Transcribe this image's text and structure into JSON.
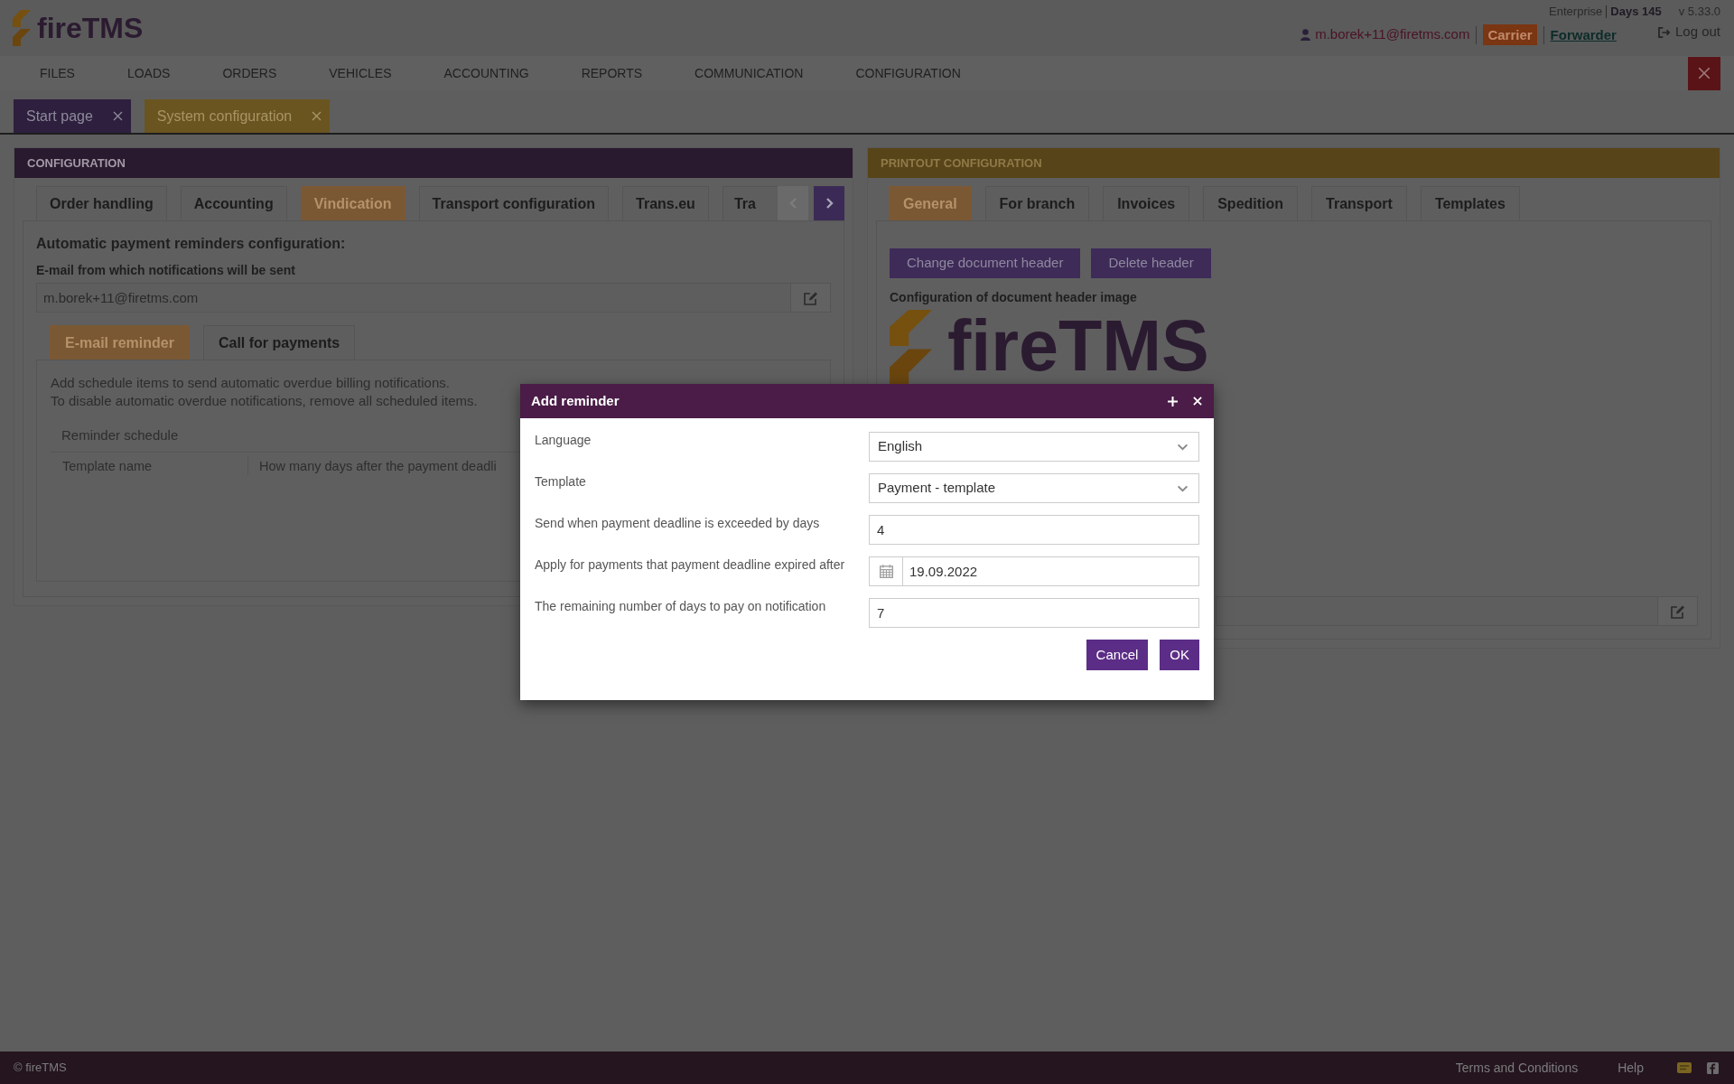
{
  "header": {
    "logo": "fireTMS",
    "edition": "Enterprise",
    "days": "Days 145",
    "version": "v 5.33.0",
    "user": "m.borek+11@firetms.com",
    "roles": [
      {
        "label": "Carrier",
        "selected": true
      },
      {
        "label": "Forwarder",
        "selected": false
      }
    ],
    "logout": "Log out"
  },
  "menu": [
    "FILES",
    "LOADS",
    "ORDERS",
    "VEHICLES",
    "ACCOUNTING",
    "REPORTS",
    "COMMUNICATION",
    "CONFIGURATION"
  ],
  "page_tabs": [
    {
      "label": "Start page",
      "selected": false
    },
    {
      "label": "System configuration",
      "selected": true
    }
  ],
  "configuration": {
    "title": "CONFIGURATION",
    "tabs": [
      {
        "label": "Order handling",
        "selected": false
      },
      {
        "label": "Accounting",
        "selected": false
      },
      {
        "label": "Vindication",
        "selected": true
      },
      {
        "label": "Transport configuration",
        "selected": false
      },
      {
        "label": "Trans.eu",
        "selected": false
      },
      {
        "label": "Tra",
        "selected": false
      }
    ],
    "scroll_buttons": [
      {
        "kind": "prev",
        "disabled": true
      },
      {
        "kind": "next",
        "disabled": false
      }
    ],
    "heading": "Automatic payment reminders configuration:",
    "email_label": "E-mail from which notifications will be sent",
    "email_value": "m.borek+11@firetms.com",
    "subtabs": [
      {
        "label": "E-mail reminder",
        "selected": true
      },
      {
        "label": "Call for payments",
        "selected": false
      }
    ],
    "notes": [
      "Add schedule items to send automatic overdue billing notifications.",
      "To disable automatic overdue notifications, remove all scheduled items."
    ],
    "schedule": {
      "title": "Reminder schedule",
      "columns": [
        "Template name",
        "How many days after the payment deadli"
      ]
    }
  },
  "printout": {
    "title": "PRINTOUT CONFIGURATION",
    "tabs": [
      {
        "label": "General",
        "selected": true
      },
      {
        "label": "For branch",
        "selected": false
      },
      {
        "label": "Invoices",
        "selected": false
      },
      {
        "label": "Spedition",
        "selected": false
      },
      {
        "label": "Transport",
        "selected": false
      },
      {
        "label": "Templates",
        "selected": false
      }
    ],
    "buttons": [
      "Change document header",
      "Delete header"
    ],
    "image_label": "Configuration of document header image",
    "image_logo": "fireTMS"
  },
  "dialog": {
    "title": "Add reminder",
    "fields": [
      {
        "kind": "select",
        "label": "Language",
        "value": "English"
      },
      {
        "kind": "select",
        "label": "Template",
        "value": "Payment - template"
      },
      {
        "kind": "number",
        "label": "Send when payment deadline is exceeded by days",
        "value": "4"
      },
      {
        "kind": "date",
        "label": "Apply for payments that payment deadline expired after",
        "value": "19.09.2022"
      },
      {
        "kind": "number",
        "label": "The remaining number of days to pay on notification",
        "value": "7"
      }
    ],
    "buttons": [
      "Cancel",
      "OK"
    ]
  },
  "footer": {
    "copyright": "© fireTMS",
    "links": [
      "Terms and Conditions",
      "Help"
    ]
  }
}
